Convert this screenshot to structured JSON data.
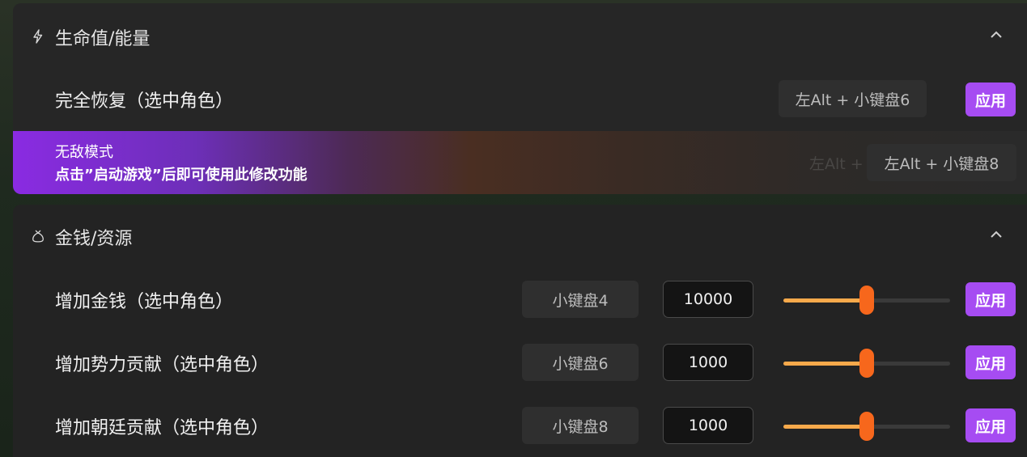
{
  "health_section": {
    "title": "生命值/能量",
    "icon": "lightning-icon",
    "rows": [
      {
        "label": "完全恢复（选中角色）",
        "hotkey": "左Alt + 小键盘6",
        "apply_label": "应用"
      }
    ],
    "banner": {
      "title": "无敌模式",
      "subtitle": "点击”启动游戏”后即可使用此修改功能",
      "ghost_hotkey": "左Alt + 小",
      "hotkey": "左Alt + 小键盘8"
    }
  },
  "money_section": {
    "title": "金钱/资源",
    "icon": "money-bag-icon",
    "rows": [
      {
        "label": "增加金钱（选中角色）",
        "hotkey": "小键盘4",
        "value": "10000",
        "slider_fraction": 0.5,
        "apply_label": "应用"
      },
      {
        "label": "增加势力贡献（选中角色）",
        "hotkey": "小键盘6",
        "value": "1000",
        "slider_fraction": 0.5,
        "apply_label": "应用"
      },
      {
        "label": "增加朝廷贡献（选中角色）",
        "hotkey": "小键盘8",
        "value": "1000",
        "slider_fraction": 0.5,
        "apply_label": "应用"
      }
    ]
  },
  "colors": {
    "accent_purple": "#a64cf2",
    "slider_fill": "#f7a94b",
    "slider_thumb": "#f7671c"
  }
}
